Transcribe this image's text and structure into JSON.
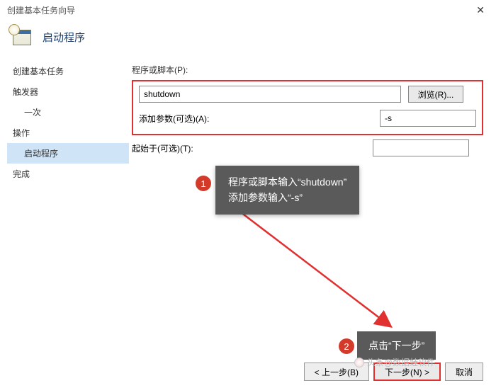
{
  "window": {
    "title": "创建基本任务向导"
  },
  "header": {
    "title": "启动程序"
  },
  "sidebar": {
    "items": [
      {
        "label": "创建基本任务"
      },
      {
        "label": "触发器"
      },
      {
        "label": "一次"
      },
      {
        "label": "操作"
      },
      {
        "label": "启动程序"
      },
      {
        "label": "完成"
      }
    ]
  },
  "form": {
    "program_label": "程序或脚本(P):",
    "program_value": "shutdown",
    "browse_label": "浏览(R)...",
    "args_label": "添加参数(可选)(A):",
    "args_value": "-s",
    "startin_label": "起始于(可选)(T):",
    "startin_value": ""
  },
  "annotations": {
    "badge1": "1",
    "callout1_line1": "程序或脚本输入“shutdown”",
    "callout1_line2": "添加参数输入“-s”",
    "badge2": "2",
    "callout2": "点击“下一步”"
  },
  "footer": {
    "back": "< 上一步(B)",
    "next": "下一步(N) >",
    "cancel": "取消"
  },
  "watermark": "头条@数据蛙软件"
}
